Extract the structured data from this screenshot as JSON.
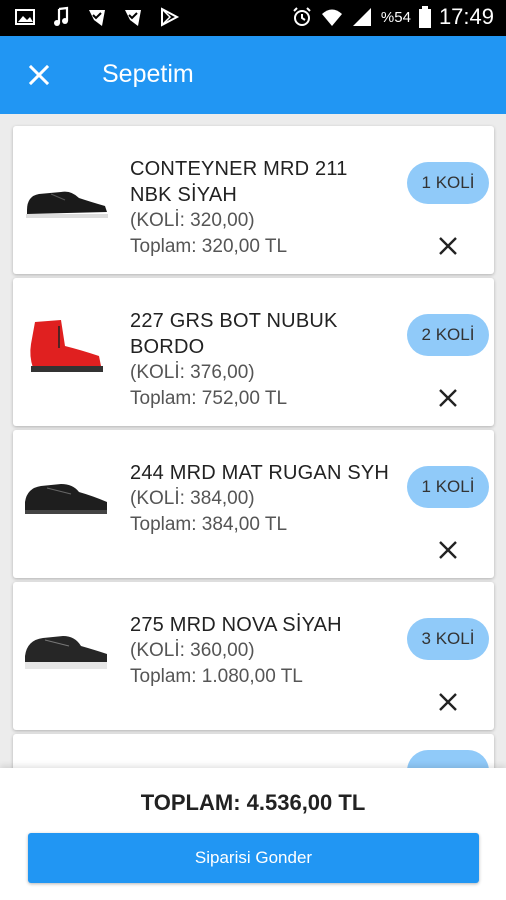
{
  "status_bar": {
    "battery_percent": "%54",
    "time": "17:49",
    "left_icons": [
      "image-icon",
      "music-icon",
      "check-badge-icon",
      "check-badge-icon",
      "play-store-icon"
    ],
    "right_icons": [
      "alarm-icon",
      "wifi-icon",
      "signal-icon",
      "battery-icon"
    ]
  },
  "header": {
    "title": "Sepetim",
    "close_icon": "close-icon"
  },
  "cart": {
    "items": [
      {
        "name_line1": "CONTEYNER MRD 211",
        "name_line2": "NBK SİYAH",
        "unit_price": "(KOLİ: 320,00)",
        "total": "Toplam: 320,00 TL",
        "quantity": "1 KOLİ",
        "shoe_color": "#1a1a1a"
      },
      {
        "name_line1": "227 GRS BOT NUBUK",
        "name_line2": "BORDO",
        "unit_price": "(KOLİ: 376,00)",
        "total": "Toplam: 752,00 TL",
        "quantity": "2 KOLİ",
        "shoe_color": "#e02020"
      },
      {
        "name_line1": "244 MRD MAT RUGAN SYH",
        "name_line2": "",
        "unit_price": "(KOLİ: 384,00)",
        "total": "Toplam: 384,00 TL",
        "quantity": "1 KOLİ",
        "shoe_color": "#1e1e1e"
      },
      {
        "name_line1": "275 MRD NOVA SİYAH",
        "name_line2": "",
        "unit_price": "(KOLİ: 360,00)",
        "total": "Toplam: 1.080,00 TL",
        "quantity": "3 KOLİ",
        "shoe_color": "#262626"
      }
    ]
  },
  "footer": {
    "total_label": "TOPLAM: 4.536,00 TL",
    "submit_label": "Siparisi Gonder"
  },
  "colors": {
    "primary": "#2196f3",
    "qty_pill": "#90caf9"
  }
}
